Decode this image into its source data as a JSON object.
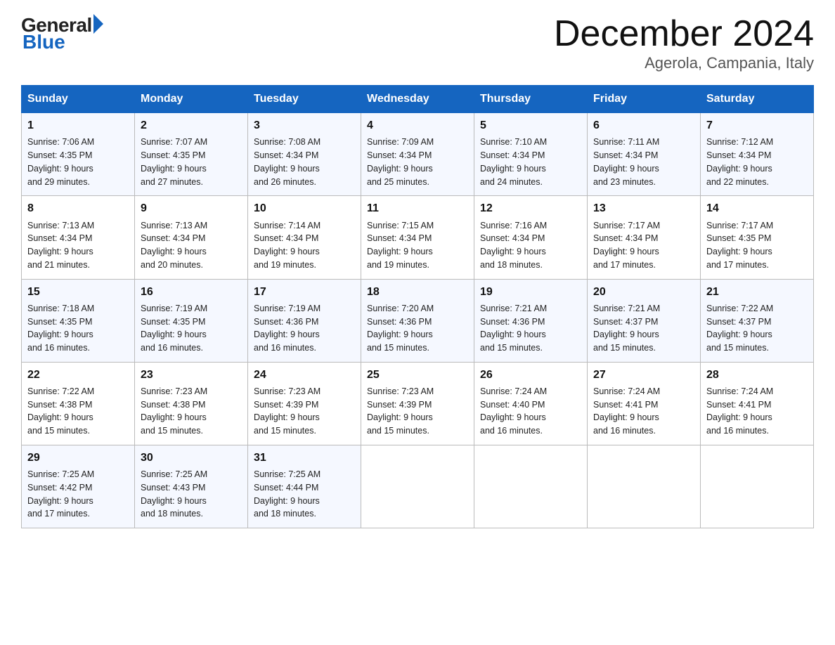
{
  "header": {
    "logo_general": "General",
    "logo_blue": "Blue",
    "month_title": "December 2024",
    "location": "Agerola, Campania, Italy"
  },
  "days_of_week": [
    "Sunday",
    "Monday",
    "Tuesday",
    "Wednesday",
    "Thursday",
    "Friday",
    "Saturday"
  ],
  "weeks": [
    [
      {
        "num": "1",
        "sunrise": "7:06 AM",
        "sunset": "4:35 PM",
        "daylight": "9 hours and 29 minutes."
      },
      {
        "num": "2",
        "sunrise": "7:07 AM",
        "sunset": "4:35 PM",
        "daylight": "9 hours and 27 minutes."
      },
      {
        "num": "3",
        "sunrise": "7:08 AM",
        "sunset": "4:34 PM",
        "daylight": "9 hours and 26 minutes."
      },
      {
        "num": "4",
        "sunrise": "7:09 AM",
        "sunset": "4:34 PM",
        "daylight": "9 hours and 25 minutes."
      },
      {
        "num": "5",
        "sunrise": "7:10 AM",
        "sunset": "4:34 PM",
        "daylight": "9 hours and 24 minutes."
      },
      {
        "num": "6",
        "sunrise": "7:11 AM",
        "sunset": "4:34 PM",
        "daylight": "9 hours and 23 minutes."
      },
      {
        "num": "7",
        "sunrise": "7:12 AM",
        "sunset": "4:34 PM",
        "daylight": "9 hours and 22 minutes."
      }
    ],
    [
      {
        "num": "8",
        "sunrise": "7:13 AM",
        "sunset": "4:34 PM",
        "daylight": "9 hours and 21 minutes."
      },
      {
        "num": "9",
        "sunrise": "7:13 AM",
        "sunset": "4:34 PM",
        "daylight": "9 hours and 20 minutes."
      },
      {
        "num": "10",
        "sunrise": "7:14 AM",
        "sunset": "4:34 PM",
        "daylight": "9 hours and 19 minutes."
      },
      {
        "num": "11",
        "sunrise": "7:15 AM",
        "sunset": "4:34 PM",
        "daylight": "9 hours and 19 minutes."
      },
      {
        "num": "12",
        "sunrise": "7:16 AM",
        "sunset": "4:34 PM",
        "daylight": "9 hours and 18 minutes."
      },
      {
        "num": "13",
        "sunrise": "7:17 AM",
        "sunset": "4:34 PM",
        "daylight": "9 hours and 17 minutes."
      },
      {
        "num": "14",
        "sunrise": "7:17 AM",
        "sunset": "4:35 PM",
        "daylight": "9 hours and 17 minutes."
      }
    ],
    [
      {
        "num": "15",
        "sunrise": "7:18 AM",
        "sunset": "4:35 PM",
        "daylight": "9 hours and 16 minutes."
      },
      {
        "num": "16",
        "sunrise": "7:19 AM",
        "sunset": "4:35 PM",
        "daylight": "9 hours and 16 minutes."
      },
      {
        "num": "17",
        "sunrise": "7:19 AM",
        "sunset": "4:36 PM",
        "daylight": "9 hours and 16 minutes."
      },
      {
        "num": "18",
        "sunrise": "7:20 AM",
        "sunset": "4:36 PM",
        "daylight": "9 hours and 15 minutes."
      },
      {
        "num": "19",
        "sunrise": "7:21 AM",
        "sunset": "4:36 PM",
        "daylight": "9 hours and 15 minutes."
      },
      {
        "num": "20",
        "sunrise": "7:21 AM",
        "sunset": "4:37 PM",
        "daylight": "9 hours and 15 minutes."
      },
      {
        "num": "21",
        "sunrise": "7:22 AM",
        "sunset": "4:37 PM",
        "daylight": "9 hours and 15 minutes."
      }
    ],
    [
      {
        "num": "22",
        "sunrise": "7:22 AM",
        "sunset": "4:38 PM",
        "daylight": "9 hours and 15 minutes."
      },
      {
        "num": "23",
        "sunrise": "7:23 AM",
        "sunset": "4:38 PM",
        "daylight": "9 hours and 15 minutes."
      },
      {
        "num": "24",
        "sunrise": "7:23 AM",
        "sunset": "4:39 PM",
        "daylight": "9 hours and 15 minutes."
      },
      {
        "num": "25",
        "sunrise": "7:23 AM",
        "sunset": "4:39 PM",
        "daylight": "9 hours and 15 minutes."
      },
      {
        "num": "26",
        "sunrise": "7:24 AM",
        "sunset": "4:40 PM",
        "daylight": "9 hours and 16 minutes."
      },
      {
        "num": "27",
        "sunrise": "7:24 AM",
        "sunset": "4:41 PM",
        "daylight": "9 hours and 16 minutes."
      },
      {
        "num": "28",
        "sunrise": "7:24 AM",
        "sunset": "4:41 PM",
        "daylight": "9 hours and 16 minutes."
      }
    ],
    [
      {
        "num": "29",
        "sunrise": "7:25 AM",
        "sunset": "4:42 PM",
        "daylight": "9 hours and 17 minutes."
      },
      {
        "num": "30",
        "sunrise": "7:25 AM",
        "sunset": "4:43 PM",
        "daylight": "9 hours and 18 minutes."
      },
      {
        "num": "31",
        "sunrise": "7:25 AM",
        "sunset": "4:44 PM",
        "daylight": "9 hours and 18 minutes."
      },
      null,
      null,
      null,
      null
    ]
  ],
  "labels": {
    "sunrise": "Sunrise:",
    "sunset": "Sunset:",
    "daylight": "Daylight:"
  }
}
